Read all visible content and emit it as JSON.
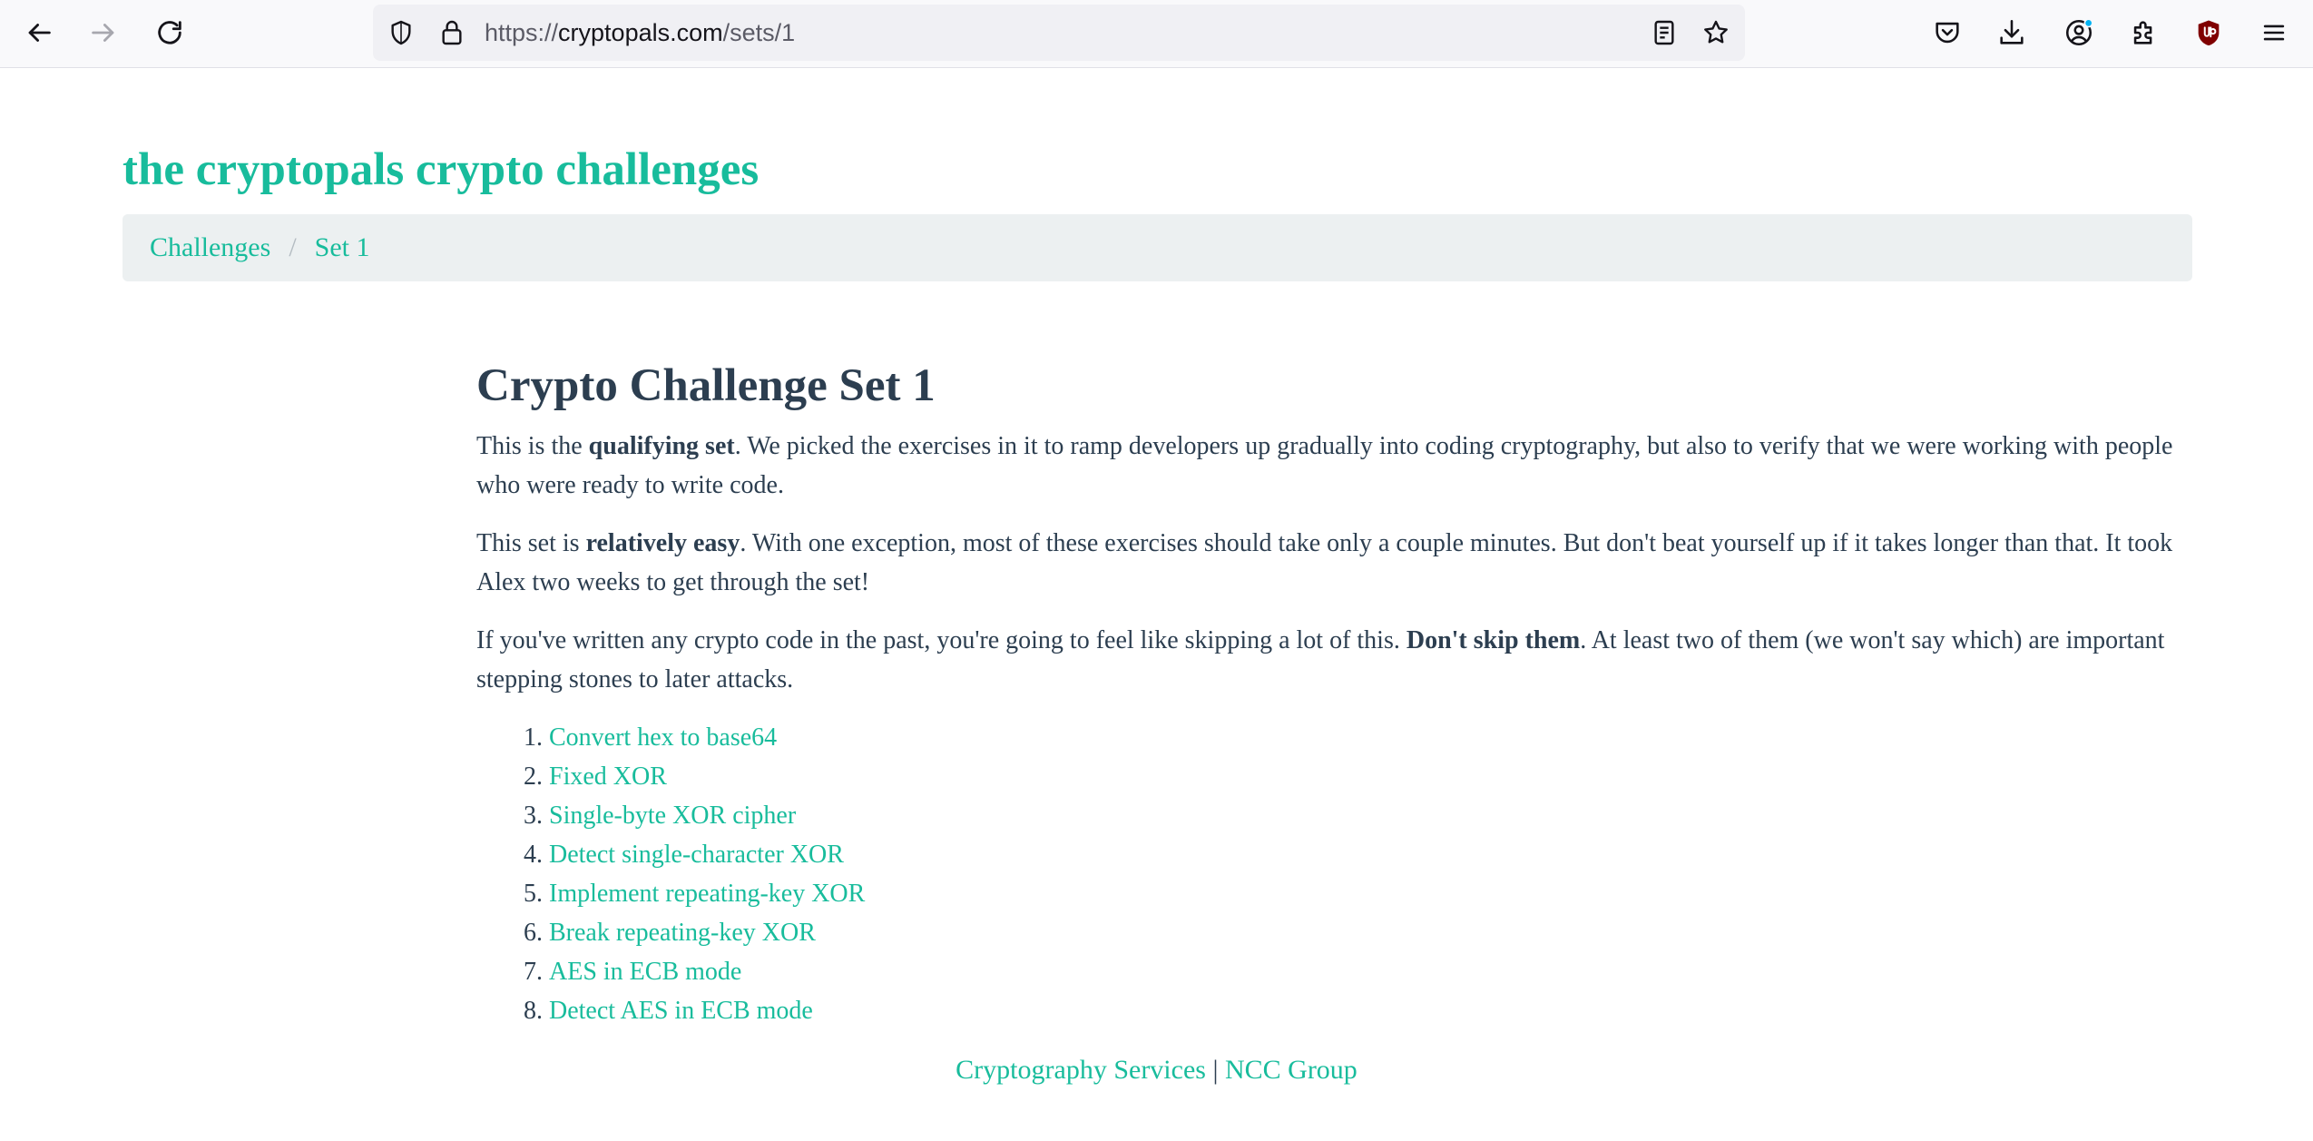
{
  "browser": {
    "url_scheme": "https://",
    "url_host": "cryptopals.com",
    "url_path": "/sets/1",
    "icons": {
      "back": "arrow-left-icon",
      "forward": "arrow-right-icon",
      "reload": "reload-icon",
      "tracking_protection": "shield-icon",
      "lock": "lock-icon",
      "reader_view": "reader-view-icon",
      "bookmark": "star-icon",
      "pocket": "pocket-icon",
      "downloads": "download-icon",
      "account": "account-icon",
      "extensions": "puzzle-icon",
      "ublock": "ublock-icon",
      "menu": "hamburger-menu-icon"
    },
    "account_badge_color": "#00b3f4",
    "ublock_color": "#800000"
  },
  "site": {
    "title": "the cryptopals crypto challenges",
    "accent_color": "#18bc9c",
    "text_color": "#2c3e50"
  },
  "breadcrumb": {
    "items": [
      "Challenges",
      "Set 1"
    ],
    "separator": "/"
  },
  "main": {
    "heading": "Crypto Challenge Set 1",
    "paragraphs": [
      {
        "before": "This is the ",
        "bold": "qualifying set",
        "after": ". We picked the exercises in it to ramp developers up gradually into coding cryptography, but also to verify that we were working with people who were ready to write code."
      },
      {
        "before": "This set is ",
        "bold": "relatively easy",
        "after": ". With one exception, most of these exercises should take only a couple minutes. But don't beat yourself up if it takes longer than that. It took Alex two weeks to get through the set!"
      },
      {
        "before": "If you've written any crypto code in the past, you're going to feel like skipping a lot of this. ",
        "bold": "Don't skip them",
        "after": ". At least two of them (we won't say which) are important stepping stones to later attacks."
      }
    ],
    "challenges": [
      "Convert hex to base64",
      "Fixed XOR",
      "Single-byte XOR cipher",
      "Detect single-character XOR",
      "Implement repeating-key XOR",
      "Break repeating-key XOR",
      "AES in ECB mode",
      "Detect AES in ECB mode"
    ]
  },
  "footer": {
    "left_link": "Cryptography Services",
    "divider": "|",
    "right_link": "NCC Group"
  }
}
